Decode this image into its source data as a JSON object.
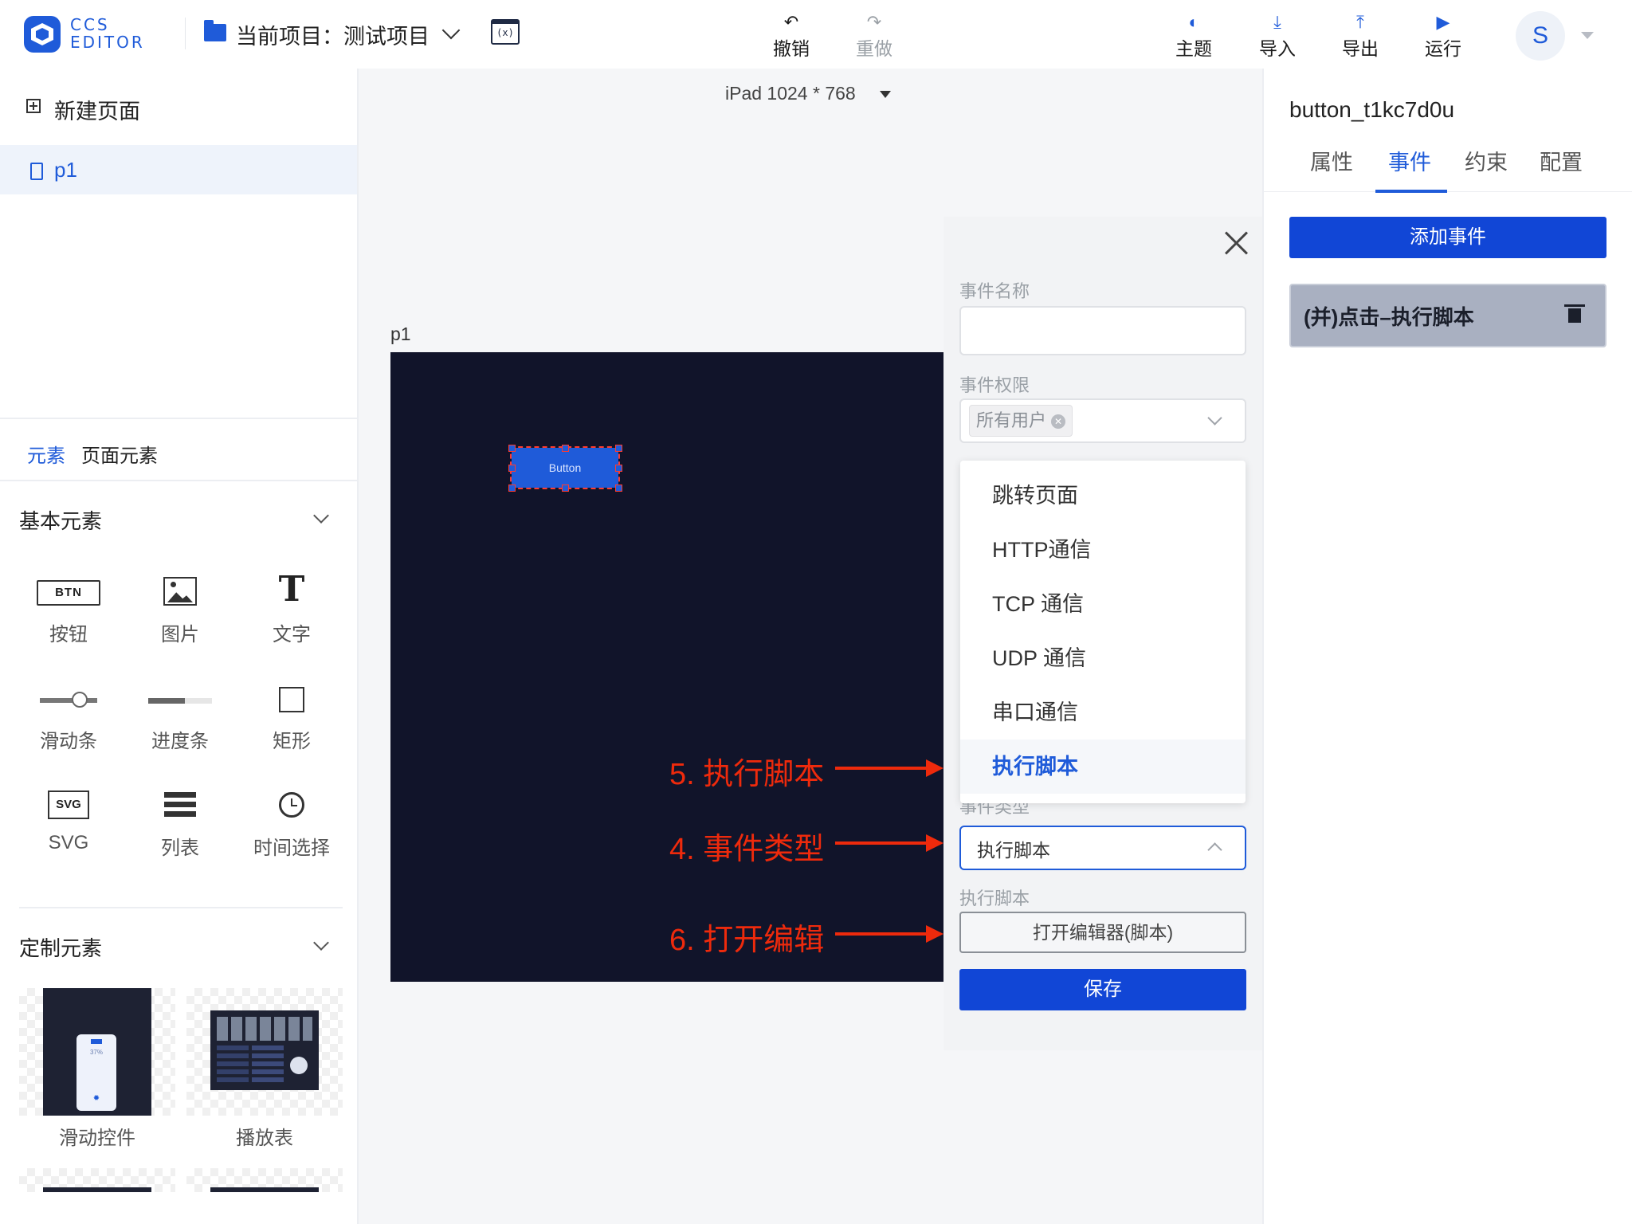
{
  "header": {
    "logo_line1": "CCS",
    "logo_line2": "EDITOR",
    "project_label": "当前项目：测试项目",
    "var_icon_text": "(x)",
    "undo": "撤销",
    "redo": "重做",
    "theme": "主题",
    "import": "导入",
    "export": "导出",
    "run": "运行",
    "avatar": "S"
  },
  "sidebar": {
    "new_page": "新建页面",
    "pages": [
      "p1"
    ],
    "tabs": [
      "元素",
      "页面元素"
    ],
    "basic_section": "基本元素",
    "basic_items": [
      {
        "label": "按钮",
        "icon": "button-icon",
        "icon_text": "BTN"
      },
      {
        "label": "图片",
        "icon": "image-icon"
      },
      {
        "label": "文字",
        "icon": "text-icon",
        "icon_text": "T"
      },
      {
        "label": "滑动条",
        "icon": "slider-icon"
      },
      {
        "label": "进度条",
        "icon": "progress-icon"
      },
      {
        "label": "矩形",
        "icon": "rectangle-icon"
      },
      {
        "label": "SVG",
        "icon": "svg-icon",
        "icon_text": "SVG"
      },
      {
        "label": "列表",
        "icon": "list-icon"
      },
      {
        "label": "时间选择",
        "icon": "clock-icon"
      }
    ],
    "custom_section": "定制元素",
    "custom_items": [
      {
        "label": "滑动控件",
        "thumb_text": "37%"
      },
      {
        "label": "播放表"
      }
    ]
  },
  "canvas": {
    "device": "iPad 1024 * 768",
    "page_name": "p1",
    "button_text": "Button"
  },
  "dialog": {
    "event_name_label": "事件名称",
    "event_name_value": "",
    "permission_label": "事件权限",
    "permission_tag": "所有用户",
    "dropdown_options": [
      "跳转页面",
      "HTTP通信",
      "TCP 通信",
      "UDP 通信",
      "串口通信",
      "执行脚本"
    ],
    "selected_option": "执行脚本",
    "event_type_label": "事件类型",
    "event_type_value": "执行脚本",
    "script_label": "执行脚本",
    "open_editor": "打开编辑器(脚本)",
    "save": "保存"
  },
  "annotations": {
    "step5": "5. 执行脚本",
    "step4": "4. 事件类型",
    "step6": "6. 打开编辑"
  },
  "right_panel": {
    "component_name": "button_t1kc7d0u",
    "tabs": [
      "属性",
      "事件",
      "约束",
      "配置"
    ],
    "active_tab": "事件",
    "add_event": "添加事件",
    "events": [
      "(并)点击–执行脚本"
    ]
  },
  "colors": {
    "primary": "#1f5bd9",
    "button_blue": "#1146d6",
    "canvas_dark": "#11142a",
    "annotation_red": "#ee2a0c"
  }
}
